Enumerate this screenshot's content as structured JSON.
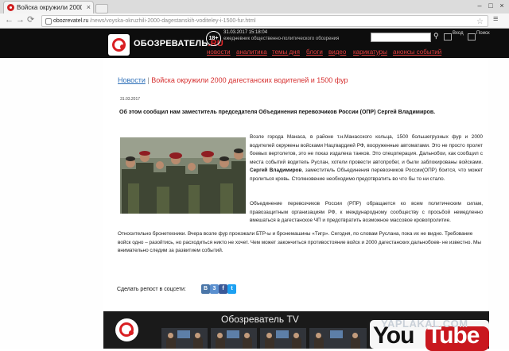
{
  "browser": {
    "tab_title": "Войска окружили 2000 даг...",
    "tab_close": "×",
    "url_host": "obozrevatel.ru",
    "url_path": "/news/voyska-okruzhili-2000-dagestanskih-voditeley-i-1500-fur.html",
    "window_controls": [
      "–",
      "□",
      "×"
    ]
  },
  "site": {
    "brand_main": "ОБОЗРЕВАТЕЛЬ",
    "brand_suffix": ".RU",
    "age_badge": "18+",
    "datetime": "31.03.2017 15:18:04",
    "tagline": "ежедневник общественно-политического обозрения",
    "social": [
      "Вход",
      "Поиск"
    ],
    "nav": [
      "новости",
      "аналитика",
      "темы дня",
      "блоги",
      "видео",
      "карикатуры",
      "анонсы событий"
    ]
  },
  "article": {
    "breadcrumb": "Новости",
    "separator": " | ",
    "title": "Войска окружили 2000 дагестанских водителей и 1500 фур",
    "date": "31.03.2017",
    "lead": "Об этом сообщил нам заместитель председателя Объединения перевозчиков России (ОПР) Сергей Владимиров.",
    "p1_a": "Возле города Манаса, в районе т.н.Манасского кольца, 1500 большегрузных фур и 2000 водителей окружены войсками Нацгвардией РФ, вооруженные автоматами. Это не просто пролет боевых вертолетов, это не показ издалека танков. Это спецоперация. Дальнобои, как сообщил с места событий водитель Руслан, хотели провести автопробег, и были заблокированы войсками. ",
    "p1_bold": "Сергей Владимиров",
    "p1_b": ", заместитель Объединения перевозчиков России(ОПР) боится, что может пролиться кровь. Столкновение необходимо предотвратить во что бы то ни стало.",
    "p2": "Объединение перевозчиков России (РПР) обращается ко всем политическим силам, правозащитным организациям РФ, к международному сообществу с просьбой немедленно вмешаться в дагестанское ЧП и предотвратить возможное массовое кровопролитие.",
    "p3": "Относительно бронетехники. Вчера возле фур проезжали БТР-ы и бронемашины «Тигр». Сегодня, по словам Руслана, пока их не видно. Требование войск одно – разойтись, но расходиться никто не хочет. Чем может закончиться противостояние войск и 2000 дагестанских дальнобоев- не известно. Мы внимательно следим за развитием событий.",
    "share_label": "Сделать репост в соцсети:",
    "share_buttons": [
      {
        "label": "В",
        "color": "#4a76a8"
      },
      {
        "label": "3",
        "color": "#5a8fcf"
      },
      {
        "label": "f",
        "color": "#3b5998"
      },
      {
        "label": "t",
        "color": "#1da1f2"
      }
    ]
  },
  "tv": {
    "title": "Обозреватель TV",
    "youtube_you": "You",
    "youtube_tube": "Tube"
  },
  "watermark": "YAPLAKAL.COM",
  "colors": {
    "accent_red": "#d91e22",
    "link_blue": "#2d6fb8",
    "header_bg": "#0d0d0d"
  }
}
